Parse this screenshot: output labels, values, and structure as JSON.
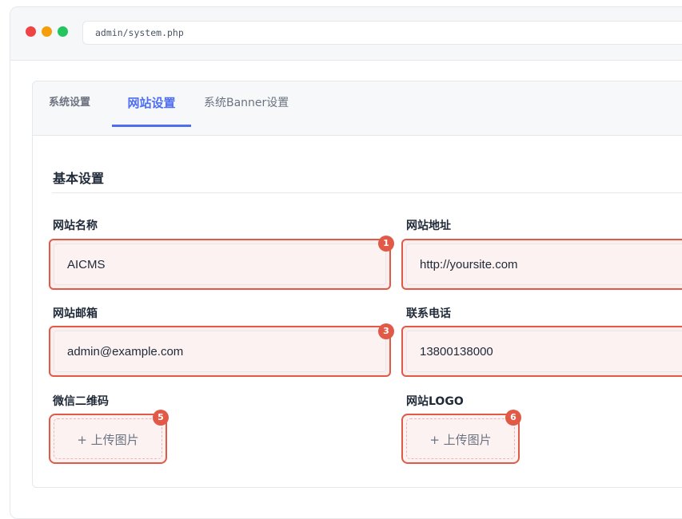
{
  "browser": {
    "url": "admin/system.php"
  },
  "tabs": [
    {
      "label": "系统设置"
    },
    {
      "label": "网站设置"
    },
    {
      "label": "系统Banner设置"
    }
  ],
  "active_tab": "网站设置",
  "section": {
    "title": "基本设置"
  },
  "fields": {
    "site_name": {
      "label": "网站名称",
      "value": "AICMS",
      "badge": "1"
    },
    "site_url": {
      "label": "网站地址",
      "value": "http://yoursite.com"
    },
    "site_email": {
      "label": "网站邮箱",
      "value": "admin@example.com",
      "badge": "3"
    },
    "contact_phone": {
      "label": "联系电话",
      "value": "13800138000"
    },
    "wechat_qr": {
      "label": "微信二维码",
      "upload_label": "+ 上传图片",
      "badge": "5"
    },
    "site_logo": {
      "label": "网站LOGO",
      "upload_label": "+ 上传图片",
      "badge": "6"
    }
  },
  "colors": {
    "accent": "#4e6ef2",
    "highlight": "#e05a47"
  }
}
